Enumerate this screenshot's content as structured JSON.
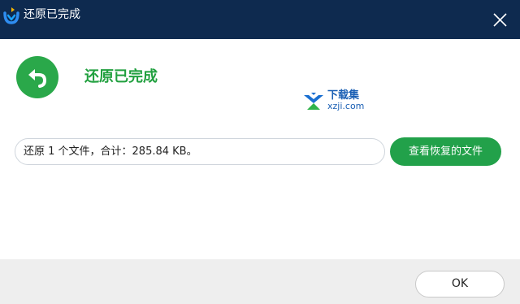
{
  "window": {
    "title": "还原已完成",
    "icons": {
      "app": "app-logo-icon",
      "close": "close-icon"
    }
  },
  "status": {
    "heading": "还原已完成",
    "icon": "undo-arrow-icon",
    "accent_color": "#22a14a"
  },
  "watermark": {
    "cn": "下载集",
    "en": "xzji.com"
  },
  "result": {
    "summary": "还原 1 个文件，合计：285.84 KB。",
    "view_button_label": "查看恢复的文件"
  },
  "footer": {
    "ok_label": "OK"
  }
}
